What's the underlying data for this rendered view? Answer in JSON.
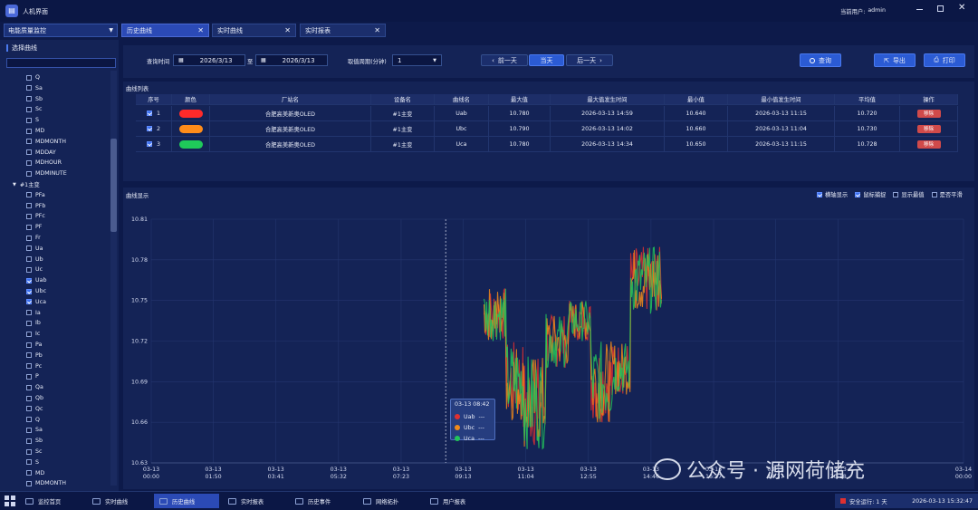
{
  "app": {
    "title": "人机界面",
    "user_label": "当前用户:",
    "user": "admin"
  },
  "nav": {
    "module_select": "电能质量监控",
    "tabs": [
      {
        "label": "历史曲线",
        "active": true
      },
      {
        "label": "实时曲线",
        "active": false
      },
      {
        "label": "实时报表",
        "active": false
      }
    ]
  },
  "sidebar": {
    "header": "选择曲线",
    "items": [
      {
        "label": "Q",
        "checked": false
      },
      {
        "label": "Sa",
        "checked": false
      },
      {
        "label": "Sb",
        "checked": false
      },
      {
        "label": "Sc",
        "checked": false
      },
      {
        "label": "S",
        "checked": false
      },
      {
        "label": "MD",
        "checked": false
      },
      {
        "label": "MDMONTH",
        "checked": false
      },
      {
        "label": "MDDAY",
        "checked": false
      },
      {
        "label": "MDHOUR",
        "checked": false
      },
      {
        "label": "MDMINUTE",
        "checked": false
      },
      {
        "label": "#1主变",
        "group": true
      },
      {
        "label": "PFa",
        "checked": false
      },
      {
        "label": "PFb",
        "checked": false
      },
      {
        "label": "PFc",
        "checked": false
      },
      {
        "label": "PF",
        "checked": false
      },
      {
        "label": "Fr",
        "checked": false
      },
      {
        "label": "Ua",
        "checked": false
      },
      {
        "label": "Ub",
        "checked": false
      },
      {
        "label": "Uc",
        "checked": false
      },
      {
        "label": "Uab",
        "checked": true
      },
      {
        "label": "Ubc",
        "checked": true
      },
      {
        "label": "Uca",
        "checked": true
      },
      {
        "label": "Ia",
        "checked": false
      },
      {
        "label": "Ib",
        "checked": false
      },
      {
        "label": "Ic",
        "checked": false
      },
      {
        "label": "Pa",
        "checked": false
      },
      {
        "label": "Pb",
        "checked": false
      },
      {
        "label": "Pc",
        "checked": false
      },
      {
        "label": "P",
        "checked": false
      },
      {
        "label": "Qa",
        "checked": false
      },
      {
        "label": "Qb",
        "checked": false
      },
      {
        "label": "Qc",
        "checked": false
      },
      {
        "label": "Q",
        "checked": false
      },
      {
        "label": "Sa",
        "checked": false
      },
      {
        "label": "Sb",
        "checked": false
      },
      {
        "label": "Sc",
        "checked": false
      },
      {
        "label": "S",
        "checked": false
      },
      {
        "label": "MD",
        "checked": false
      },
      {
        "label": "MDMONTH",
        "checked": false
      }
    ]
  },
  "query": {
    "time_label": "查询时间",
    "start_date": "2026/3/13",
    "to_label": "至",
    "end_date": "2026/3/13",
    "period_label": "取值周期(分钟)",
    "period_value": "1",
    "prev_day": "前一天",
    "today": "当天",
    "next_day": "后一天",
    "search": "查询",
    "export": "导出",
    "print": "打印"
  },
  "curve_list": {
    "title": "曲线列表",
    "columns": [
      "序号",
      "颜色",
      "厂站名",
      "设备名",
      "曲线名",
      "最大值",
      "最大值发生时间",
      "最小值",
      "最小值发生时间",
      "平均值",
      "操作"
    ],
    "rows": [
      {
        "index": "1",
        "color": "#ff2a2a",
        "station": "合肥高美新奥OLED",
        "device": "#1主变",
        "curve": "Uab",
        "max": "10.780",
        "max_time": "2026-03-13 14:59",
        "min": "10.640",
        "min_time": "2026-03-13 11:15",
        "avg": "10.720",
        "action": "移除"
      },
      {
        "index": "2",
        "color": "#ff8c1a",
        "station": "合肥高美新奥OLED",
        "device": "#1主变",
        "curve": "Ubc",
        "max": "10.790",
        "max_time": "2026-03-13 14:02",
        "min": "10.660",
        "min_time": "2026-03-13 11:04",
        "avg": "10.730",
        "action": "移除"
      },
      {
        "index": "3",
        "color": "#1fc95a",
        "station": "合肥高美新奥OLED",
        "device": "#1主变",
        "curve": "Uca",
        "max": "10.780",
        "max_time": "2026-03-13 14:34",
        "min": "10.650",
        "min_time": "2026-03-13 11:15",
        "avg": "10.728",
        "action": "移除"
      }
    ]
  },
  "chart_panel": {
    "title": "曲线显示",
    "options": [
      {
        "label": "横轴显示",
        "checked": true
      },
      {
        "label": "鼠标捕捉",
        "checked": true
      },
      {
        "label": "显示最值",
        "checked": false
      },
      {
        "label": "是否平滑",
        "checked": false
      }
    ]
  },
  "chart_data": {
    "type": "line",
    "x_ticks": [
      [
        "03-13",
        "00:00"
      ],
      [
        "03-13",
        "01:50"
      ],
      [
        "03-13",
        "03:41"
      ],
      [
        "03-13",
        "05:32"
      ],
      [
        "03-13",
        "07:23"
      ],
      [
        "03-13",
        "09:13"
      ],
      [
        "03-13",
        "11:04"
      ],
      [
        "03-13",
        "12:55"
      ],
      [
        "03-13",
        "14:46"
      ],
      [
        "03-13",
        "16:37"
      ],
      [
        "03-13",
        "18:27"
      ],
      [
        "03-13",
        "20:18"
      ],
      [
        "03-14",
        "00:00"
      ]
    ],
    "ylim": [
      10.63,
      10.81
    ],
    "y_ticks": [
      "10.81",
      "10.78",
      "10.75",
      "10.72",
      "10.69",
      "10.66",
      "10.63"
    ],
    "series": [
      {
        "name": "Uab",
        "color": "#e03030"
      },
      {
        "name": "Ubc",
        "color": "#f08a1a"
      },
      {
        "name": "Uca",
        "color": "#22c45a"
      }
    ],
    "segments": [
      {
        "t0": "09:50",
        "t1": "10:30",
        "lo": 10.72,
        "hi": 10.76
      },
      {
        "t0": "10:30",
        "t1": "11:00",
        "lo": 10.66,
        "hi": 10.72
      },
      {
        "t0": "11:00",
        "t1": "11:40",
        "lo": 10.64,
        "hi": 10.71
      },
      {
        "t0": "11:40",
        "t1": "12:20",
        "lo": 10.7,
        "hi": 10.74
      },
      {
        "t0": "12:20",
        "t1": "13:00",
        "lo": 10.72,
        "hi": 10.75
      },
      {
        "t0": "13:00",
        "t1": "13:40",
        "lo": 10.66,
        "hi": 10.72
      },
      {
        "t0": "13:40",
        "t1": "14:10",
        "lo": 10.68,
        "hi": 10.72
      },
      {
        "t0": "14:10",
        "t1": "15:05",
        "lo": 10.74,
        "hi": 10.79
      }
    ],
    "cursor_time": "08:42",
    "tooltip": {
      "time": "03-13 08:42",
      "value": "---"
    }
  },
  "taskbar": {
    "items": [
      {
        "label": "监控首页",
        "active": false
      },
      {
        "label": "实时曲线",
        "active": false
      },
      {
        "label": "历史曲线",
        "active": true
      },
      {
        "label": "实时报表",
        "active": false
      },
      {
        "label": "历史事件",
        "active": false
      },
      {
        "label": "网络拓扑",
        "active": false
      },
      {
        "label": "用户报表",
        "active": false
      }
    ],
    "status": "安全运行: 1 天",
    "datetime": "2026-03-13 15:32:47"
  },
  "watermark": "公众号 · 源网荷储充"
}
